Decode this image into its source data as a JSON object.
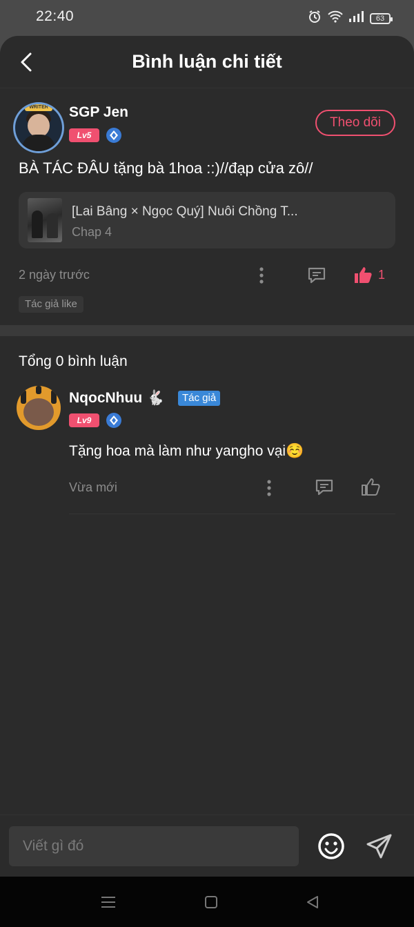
{
  "status_bar": {
    "time": "22:40",
    "battery": "63"
  },
  "header": {
    "title": "Bình luận chi tiết"
  },
  "post": {
    "username": "SGP Jen",
    "level": "Lv5",
    "follow_label": "Theo dõi",
    "text": "BÀ TÁC ĐÂU tặng bà 1hoa ::)//đạp cửa zô//",
    "story": {
      "title": "[Lai Bâng × Ngọc Quý] Nuôi Chồng T...",
      "chapter": "Chap 4"
    },
    "time": "2 ngày trước",
    "like_count": "1",
    "author_tag": "Tác giả like"
  },
  "comments": {
    "total_label": "Tổng 0 bình luận",
    "items": [
      {
        "username": "NqocNhuu",
        "level": "Lv9",
        "author_label": "Tác giả",
        "text": "Tặng hoa mà làm như yangho vại☺️",
        "time": "Vừa mới"
      }
    ]
  },
  "input": {
    "placeholder": "Viết gì đó"
  },
  "colors": {
    "accent": "#f05070",
    "author_badge": "#3a88d8",
    "level_icon": "#3a7bd5"
  },
  "icons": [
    "back-icon",
    "alarm-icon",
    "wifi-icon",
    "signal-icon",
    "battery-icon",
    "more-icon",
    "comment-icon",
    "like-icon",
    "emoji-icon",
    "send-icon",
    "menu-icon",
    "home-icon",
    "nav-back-icon"
  ]
}
